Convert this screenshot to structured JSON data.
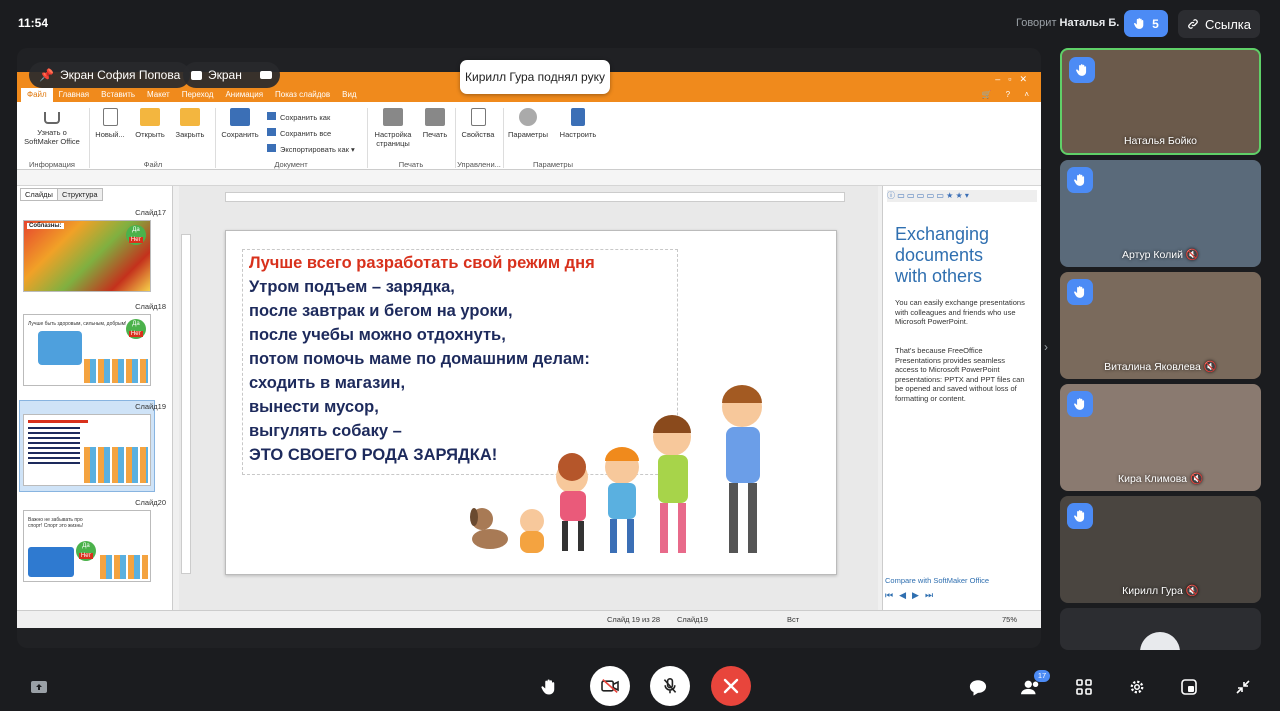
{
  "topbar": {
    "time": "11:54",
    "speaking_prefix": "Говорит",
    "speaker": "Наталья Б.",
    "hand_count": "5",
    "link_label": "Ссылка"
  },
  "stage": {
    "pill_screen_owner": "Экран София Попова",
    "pill_screen": "Экран",
    "toast": "Кирилл Гура поднял руку"
  },
  "app": {
    "tabs": [
      "Файл",
      "Главная",
      "Вставить",
      "Макет",
      "Переход",
      "Анимация",
      "Показ слайдов",
      "Вид"
    ],
    "ribbon": {
      "learn": "Узнать о SoftMaker Office",
      "new": "Новый...",
      "open": "Открыть",
      "close": "Закрыть",
      "save": "Сохранить",
      "save_as": "Сохранить как",
      "save_all": "Сохранить все",
      "export": "Экспортировать как",
      "page_setup": "Настройка страницы",
      "print": "Печать",
      "properties": "Свойства",
      "parameters": "Параметры",
      "customize": "Настроить",
      "group_info": "Информация",
      "group_file": "Файл",
      "group_document": "Документ",
      "group_print": "Печать",
      "group_manage": "Управлени...",
      "group_params": "Параметры"
    },
    "slides_panel": {
      "tab_slides": "Слайды",
      "tab_structure": "Структура",
      "labels": [
        "Слайд17",
        "Слайд18",
        "Слайд19",
        "Слайд20"
      ],
      "thumb17_title": "Соблазны:",
      "thumb18_title": "Лучше быть здоровым, сильным, добрым!",
      "thumb20_title": "Важно не забывать про спорт! Спорт это жизнь!",
      "yes": "Да",
      "no": "Нет"
    },
    "slide": {
      "lines": [
        "Лучше всего разработать свой режим дня",
        "Утром подъем –  зарядка,",
        "после завтрак и бегом на уроки,",
        "после учебы можно отдохнуть,",
        "потом помочь маме по домашним делам:",
        "сходить в магазин,",
        "вынести мусор,",
        "выгулять собаку –",
        "ЭТО СВОЕГО РОДА ЗАРЯДКА!"
      ]
    },
    "side_panel": {
      "heading": "Exchanging documents with others",
      "p1": "You can easily exchange presentations with colleagues and friends who use Microsoft PowerPoint.",
      "p2": "That's because FreeOffice Presentations provides seamless access to Microsoft PowerPoint presentations: PPTX and PPT files can be opened and saved without loss of formatting or content.",
      "link": "Compare with SoftMaker Office"
    },
    "status": {
      "slide_of": "Слайд 19 из 28",
      "slide_name": "Слайд19",
      "mode": "Вст",
      "zoom": "75%"
    }
  },
  "participants": [
    {
      "name": "Наталья Бойко",
      "active": true
    },
    {
      "name": "Артур Колий"
    },
    {
      "name": "Виталина Яковлева"
    },
    {
      "name": "Кира Климова"
    },
    {
      "name": "Кирилл Гура"
    }
  ],
  "bottombar": {
    "participants_count": "17"
  },
  "colors": {
    "accent": "#4c8bf5",
    "orange": "#f08a1c",
    "end_call": "#e8453c",
    "speaking_border": "#5fd068"
  }
}
